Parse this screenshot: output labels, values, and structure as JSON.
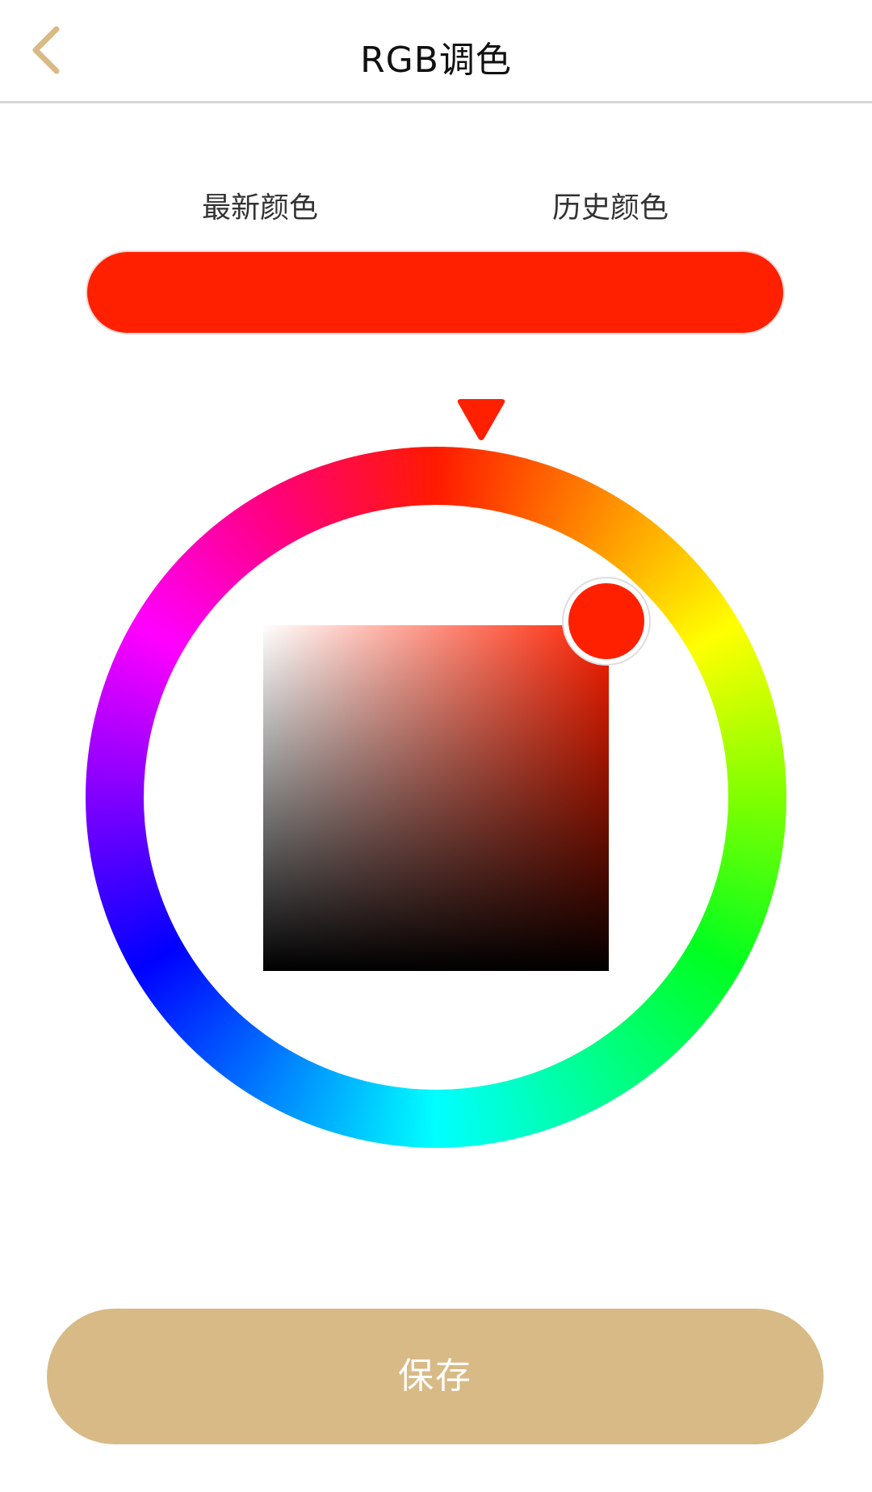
{
  "header": {
    "title": "RGB调色",
    "back_icon": "chevron-left-icon"
  },
  "tabs": [
    {
      "label": "最新颜色"
    },
    {
      "label": "历史颜色"
    }
  ],
  "color_preview": {
    "hex": "#ff2000"
  },
  "picker": {
    "selected_color": "#ff2000",
    "hue_pointer_color": "#ff2000",
    "hue_pointer_icon": "triangle-down-icon"
  },
  "colors": {
    "accent": "#d8ba86",
    "back_icon": "#d8ba86",
    "divider": "#d6d6d6"
  },
  "actions": {
    "save_label": "保存"
  }
}
